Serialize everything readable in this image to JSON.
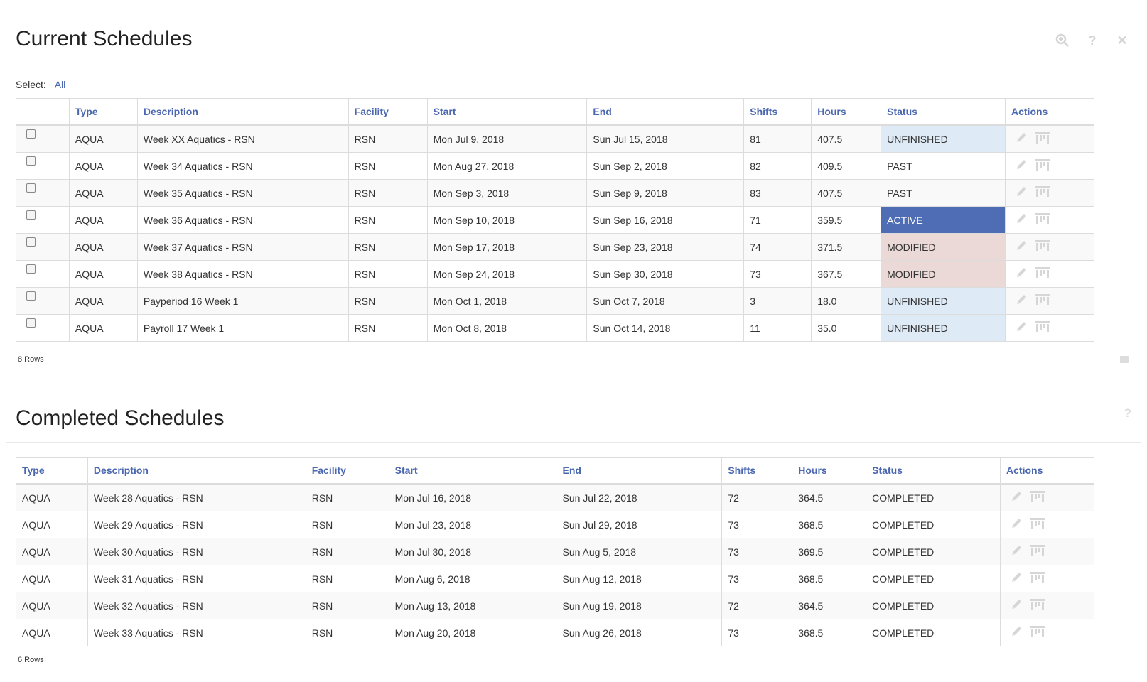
{
  "current": {
    "title": "Current Schedules",
    "select_label": "Select:",
    "select_all": "All",
    "columns": [
      "",
      "Type",
      "Description",
      "Facility",
      "Start",
      "End",
      "Shifts",
      "Hours",
      "Status",
      "Actions"
    ],
    "rows": [
      {
        "type": "AQUA",
        "description": "Week XX Aquatics - RSN",
        "facility": "RSN",
        "start": "Mon Jul 9, 2018",
        "end": "Sun Jul 15, 2018",
        "shifts": "81",
        "hours": "407.5",
        "status": "UNFINISHED"
      },
      {
        "type": "AQUA",
        "description": "Week 34 Aquatics - RSN",
        "facility": "RSN",
        "start": "Mon Aug 27, 2018",
        "end": "Sun Sep 2, 2018",
        "shifts": "82",
        "hours": "409.5",
        "status": "PAST"
      },
      {
        "type": "AQUA",
        "description": "Week 35 Aquatics - RSN",
        "facility": "RSN",
        "start": "Mon Sep 3, 2018",
        "end": "Sun Sep 9, 2018",
        "shifts": "83",
        "hours": "407.5",
        "status": "PAST"
      },
      {
        "type": "AQUA",
        "description": "Week 36 Aquatics - RSN",
        "facility": "RSN",
        "start": "Mon Sep 10, 2018",
        "end": "Sun Sep 16, 2018",
        "shifts": "71",
        "hours": "359.5",
        "status": "ACTIVE"
      },
      {
        "type": "AQUA",
        "description": "Week 37 Aquatics - RSN",
        "facility": "RSN",
        "start": "Mon Sep 17, 2018",
        "end": "Sun Sep 23, 2018",
        "shifts": "74",
        "hours": "371.5",
        "status": "MODIFIED"
      },
      {
        "type": "AQUA",
        "description": "Week 38 Aquatics - RSN",
        "facility": "RSN",
        "start": "Mon Sep 24, 2018",
        "end": "Sun Sep 30, 2018",
        "shifts": "73",
        "hours": "367.5",
        "status": "MODIFIED"
      },
      {
        "type": "AQUA",
        "description": "Payperiod 16 Week 1",
        "facility": "RSN",
        "start": "Mon Oct 1, 2018",
        "end": "Sun Oct 7, 2018",
        "shifts": "3",
        "hours": "18.0",
        "status": "UNFINISHED"
      },
      {
        "type": "AQUA",
        "description": "Payroll 17 Week 1",
        "facility": "RSN",
        "start": "Mon Oct 8, 2018",
        "end": "Sun Oct 14, 2018",
        "shifts": "11",
        "hours": "35.0",
        "status": "UNFINISHED"
      }
    ],
    "rows_count": "8 Rows"
  },
  "completed": {
    "title": "Completed Schedules",
    "columns": [
      "Type",
      "Description",
      "Facility",
      "Start",
      "End",
      "Shifts",
      "Hours",
      "Status",
      "Actions"
    ],
    "rows": [
      {
        "type": "AQUA",
        "description": "Week 28 Aquatics - RSN",
        "facility": "RSN",
        "start": "Mon Jul 16, 2018",
        "end": "Sun Jul 22, 2018",
        "shifts": "72",
        "hours": "364.5",
        "status": "COMPLETED"
      },
      {
        "type": "AQUA",
        "description": "Week 29 Aquatics - RSN",
        "facility": "RSN",
        "start": "Mon Jul 23, 2018",
        "end": "Sun Jul 29, 2018",
        "shifts": "73",
        "hours": "368.5",
        "status": "COMPLETED"
      },
      {
        "type": "AQUA",
        "description": "Week 30 Aquatics - RSN",
        "facility": "RSN",
        "start": "Mon Jul 30, 2018",
        "end": "Sun Aug 5, 2018",
        "shifts": "73",
        "hours": "369.5",
        "status": "COMPLETED"
      },
      {
        "type": "AQUA",
        "description": "Week 31 Aquatics - RSN",
        "facility": "RSN",
        "start": "Mon Aug 6, 2018",
        "end": "Sun Aug 12, 2018",
        "shifts": "73",
        "hours": "368.5",
        "status": "COMPLETED"
      },
      {
        "type": "AQUA",
        "description": "Week 32 Aquatics - RSN",
        "facility": "RSN",
        "start": "Mon Aug 13, 2018",
        "end": "Sun Aug 19, 2018",
        "shifts": "72",
        "hours": "364.5",
        "status": "COMPLETED"
      },
      {
        "type": "AQUA",
        "description": "Week 33 Aquatics - RSN",
        "facility": "RSN",
        "start": "Mon Aug 20, 2018",
        "end": "Sun Aug 26, 2018",
        "shifts": "73",
        "hours": "368.5",
        "status": "COMPLETED"
      }
    ],
    "rows_count": "6 Rows"
  },
  "icons": {
    "zoom": "zoom-in-icon",
    "help": "question-icon",
    "close": "close-icon",
    "edit": "pencil-icon",
    "view": "calendar-grid-icon",
    "export": "export-icon"
  },
  "colors": {
    "accent": "#4a67b0",
    "active_bg": "#4e6db5",
    "unfinished_bg": "#deeaf6",
    "modified_bg": "#ead9d6"
  }
}
